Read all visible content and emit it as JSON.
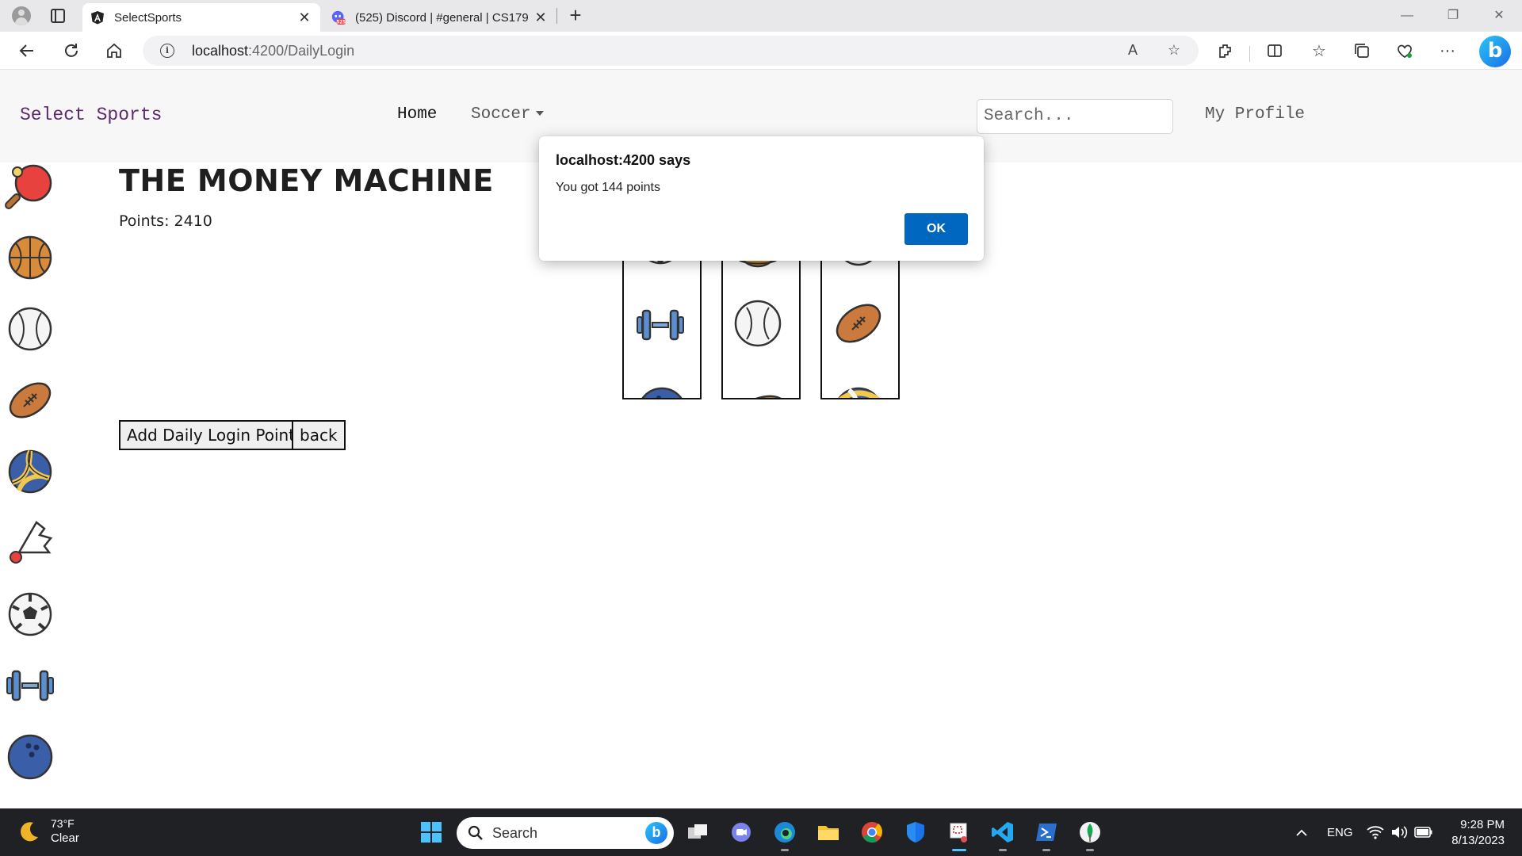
{
  "browser": {
    "tabs": [
      {
        "title": "SelectSports",
        "active": true
      },
      {
        "title": "(525) Discord | #general | CS179",
        "active": false
      }
    ],
    "discord_badge": "525",
    "url_host": "localhost",
    "url_rest": ":4200/DailyLogin"
  },
  "navbar": {
    "brand": "Select Sports",
    "links": {
      "home": "Home",
      "soccer": "Soccer",
      "profile": "My Profile"
    },
    "search_placeholder": "Search..."
  },
  "sidebar_icons": [
    "ping-pong-paddle",
    "basketball",
    "baseball",
    "american-football",
    "volleyball",
    "badminton-shuttlecock",
    "soccer-ball",
    "dumbbell",
    "bowling-ball"
  ],
  "main": {
    "heading": "THE MONEY MACHINE",
    "points_label": "Points: 2410",
    "reels": [
      {
        "center": "dumbbell",
        "top": "soccer-ball",
        "bottom": "bowling-ball"
      },
      {
        "center": "baseball",
        "top": "basketball",
        "bottom": "american-football"
      },
      {
        "center": "american-football",
        "top": "baseball",
        "bottom": "volleyball"
      }
    ],
    "buttons": {
      "add_points": "Add Daily Login Points",
      "back": "back"
    }
  },
  "alert": {
    "title": "localhost:4200 says",
    "message": "You got 144 points",
    "ok": "OK"
  },
  "taskbar": {
    "temperature": "73°F",
    "condition": "Clear",
    "search": "Search",
    "language": "ENG",
    "time": "9:28 PM",
    "date": "8/13/2023"
  },
  "colors": {
    "brand": "#5b2a6e",
    "ok_button": "#0067c0",
    "taskbar": "#202124",
    "navbar": "#f7f7f8"
  }
}
